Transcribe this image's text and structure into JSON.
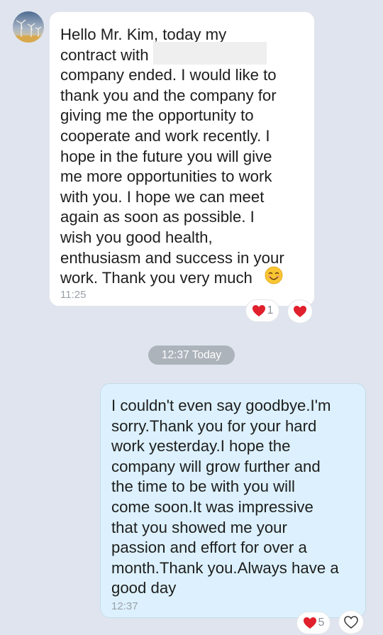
{
  "incoming": {
    "text": "Hello Mr. Kim, today my\ncontract with\ncompany ended. I would like to\nthank you and the company for\ngiving me the opportunity to\ncooperate and work recently. I\nhope in the future you will give\nme more opportunities to work\nwith you. I hope we can meet\nagain as soon as possible. I\nwish you good health,\nenthusiasm and success in your\nwork. Thank you very much",
    "time": "11:25",
    "reaction_count": "1",
    "emoji": "smiling-face-icon"
  },
  "date_separator": "12:37 Today",
  "outgoing": {
    "text": "I couldn't even say goodbye.I'm\nsorry.Thank you for your hard\nwork yesterday.I hope the\ncompany will grow further and\nthe time to be with you will\ncome soon.It was impressive\nthat you showed me your\npassion and effort for over a\nmonth.Thank you.Always have a\ngood day",
    "time": "12:37",
    "reaction_count": "5"
  },
  "colors": {
    "background": "#dfe4ee",
    "incoming_bubble": "#ffffff",
    "outgoing_bubble": "#dcf1fd",
    "heart": "#e0202c",
    "date_pill": "#adb3bb"
  }
}
